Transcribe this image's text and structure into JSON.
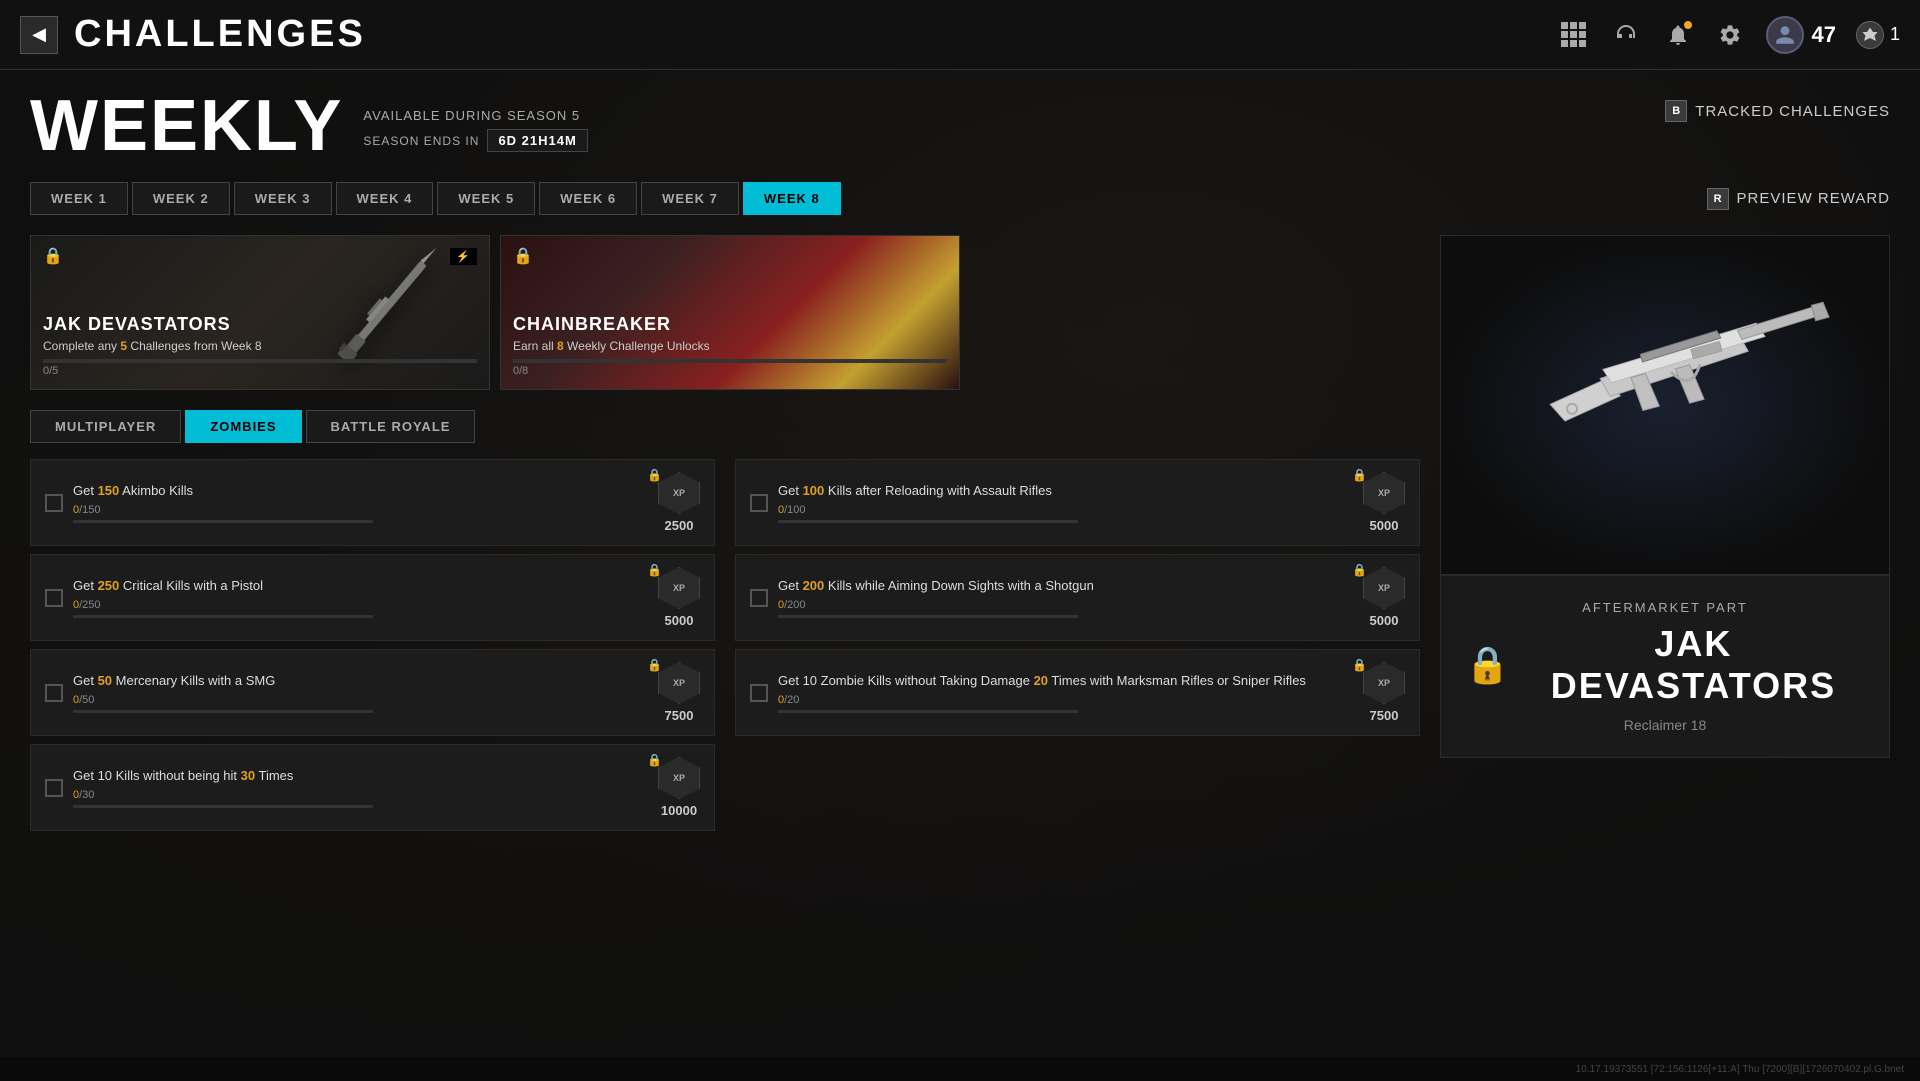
{
  "topbar": {
    "back_label": "◀",
    "title": "CHALLENGES",
    "player_level": "47",
    "prestige": "1"
  },
  "weekly": {
    "title": "WEEKLY",
    "available": "AVAILABLE DURING SEASON 5",
    "season_ends_label": "SEASON ENDS IN",
    "timer": "6d 21h14m",
    "tracked_button": "TRACKED CHALLENGES",
    "b_key": "B",
    "preview_reward": "PREVIEW REWARD",
    "r_key": "R"
  },
  "week_tabs": [
    {
      "label": "WEEK 1",
      "active": false
    },
    {
      "label": "WEEK 2",
      "active": false
    },
    {
      "label": "WEEK 3",
      "active": false
    },
    {
      "label": "WEEK 4",
      "active": false
    },
    {
      "label": "WEEK 5",
      "active": false
    },
    {
      "label": "WEEK 6",
      "active": false
    },
    {
      "label": "WEEK 7",
      "active": false
    },
    {
      "label": "WEEK 8",
      "active": true
    }
  ],
  "reward_cards": [
    {
      "title": "JAK DEVASTATORS",
      "description": "Complete any 5 Challenges from Week 8",
      "highlight": "5",
      "progress": "0/5",
      "progress_pct": 0
    },
    {
      "title": "CHAINBREAKER",
      "description": "Earn all 8 Weekly Challenge Unlocks",
      "highlight": "8",
      "progress": "0/8",
      "progress_pct": 0
    }
  ],
  "mode_tabs": [
    {
      "label": "MULTIPLAYER",
      "active": false
    },
    {
      "label": "ZOMBIES",
      "active": true
    },
    {
      "label": "BATTLE ROYALE",
      "active": false
    }
  ],
  "challenges_left": [
    {
      "title": "Get 150 Akimbo Kills",
      "highlight": "150",
      "progress_current": "0",
      "progress_max": "150",
      "progress_pct": 0,
      "xp": "2500"
    },
    {
      "title": "Get 250 Critical Kills with a Pistol",
      "highlight": "250",
      "progress_current": "0",
      "progress_max": "250",
      "progress_pct": 0,
      "xp": "5000"
    },
    {
      "title": "Get 50 Mercenary Kills with a SMG",
      "highlight": "50",
      "progress_current": "0",
      "progress_max": "50",
      "progress_pct": 0,
      "xp": "7500"
    },
    {
      "title": "Get 10 Kills without being hit 30 Times",
      "highlight": "30",
      "progress_current": "0",
      "progress_max": "30",
      "progress_pct": 0,
      "xp": "10000"
    }
  ],
  "challenges_right": [
    {
      "title": "Get 100 Kills after Reloading with Assault Rifles",
      "highlight": "100",
      "progress_current": "0",
      "progress_max": "100",
      "progress_pct": 0,
      "xp": "5000"
    },
    {
      "title": "Get 200 Kills while Aiming Down Sights with a Shotgun",
      "highlight": "200",
      "progress_current": "0",
      "progress_max": "200",
      "progress_pct": 0,
      "xp": "5000"
    },
    {
      "title": "Get 10 Zombie Kills without Taking Damage 20 Times with Marksman Rifles or Sniper Rifles",
      "highlight": "20",
      "progress_current": "0",
      "progress_max": "20",
      "progress_pct": 0,
      "xp": "7500"
    }
  ],
  "weapon_panel": {
    "aftermarket_label": "AFTERMARKET PART",
    "weapon_name": "JAK DEVASTATORS",
    "weapon_sub": "Reclaimer 18",
    "lock": "🔒"
  },
  "debug": "10.17.19373551 [72:156:1126[+11:A] Thu [7200][B][1726070402.pl.G.bnet"
}
